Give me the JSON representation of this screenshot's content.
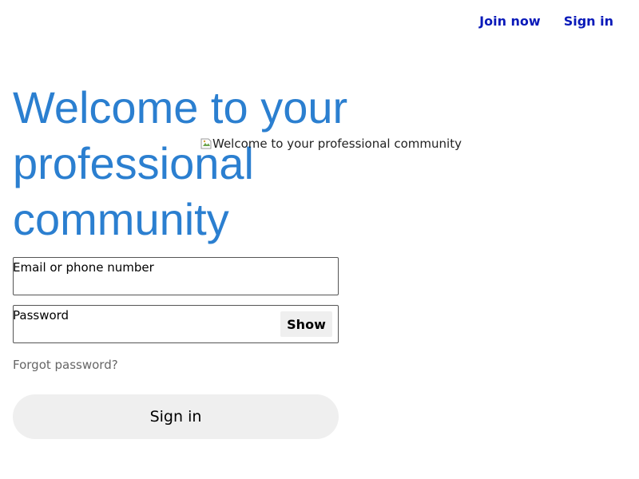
{
  "header": {
    "join_now_label": "Join now",
    "sign_in_label": "Sign in"
  },
  "main": {
    "headline": "Welcome to your professional community",
    "hero_image_alt": "Welcome to your professional community"
  },
  "form": {
    "email": {
      "label": "Email or phone number",
      "value": ""
    },
    "password": {
      "label": "Password",
      "value": "",
      "show_label": "Show"
    },
    "forgot_password_label": "Forgot password?",
    "submit_label": "Sign in"
  },
  "colors": {
    "headline": "#2b7fd0",
    "nav_link": "#0a1ab9",
    "button_bg": "#efefef",
    "muted_text": "#666666"
  },
  "icons": {
    "hero_image": "broken-image-icon"
  }
}
